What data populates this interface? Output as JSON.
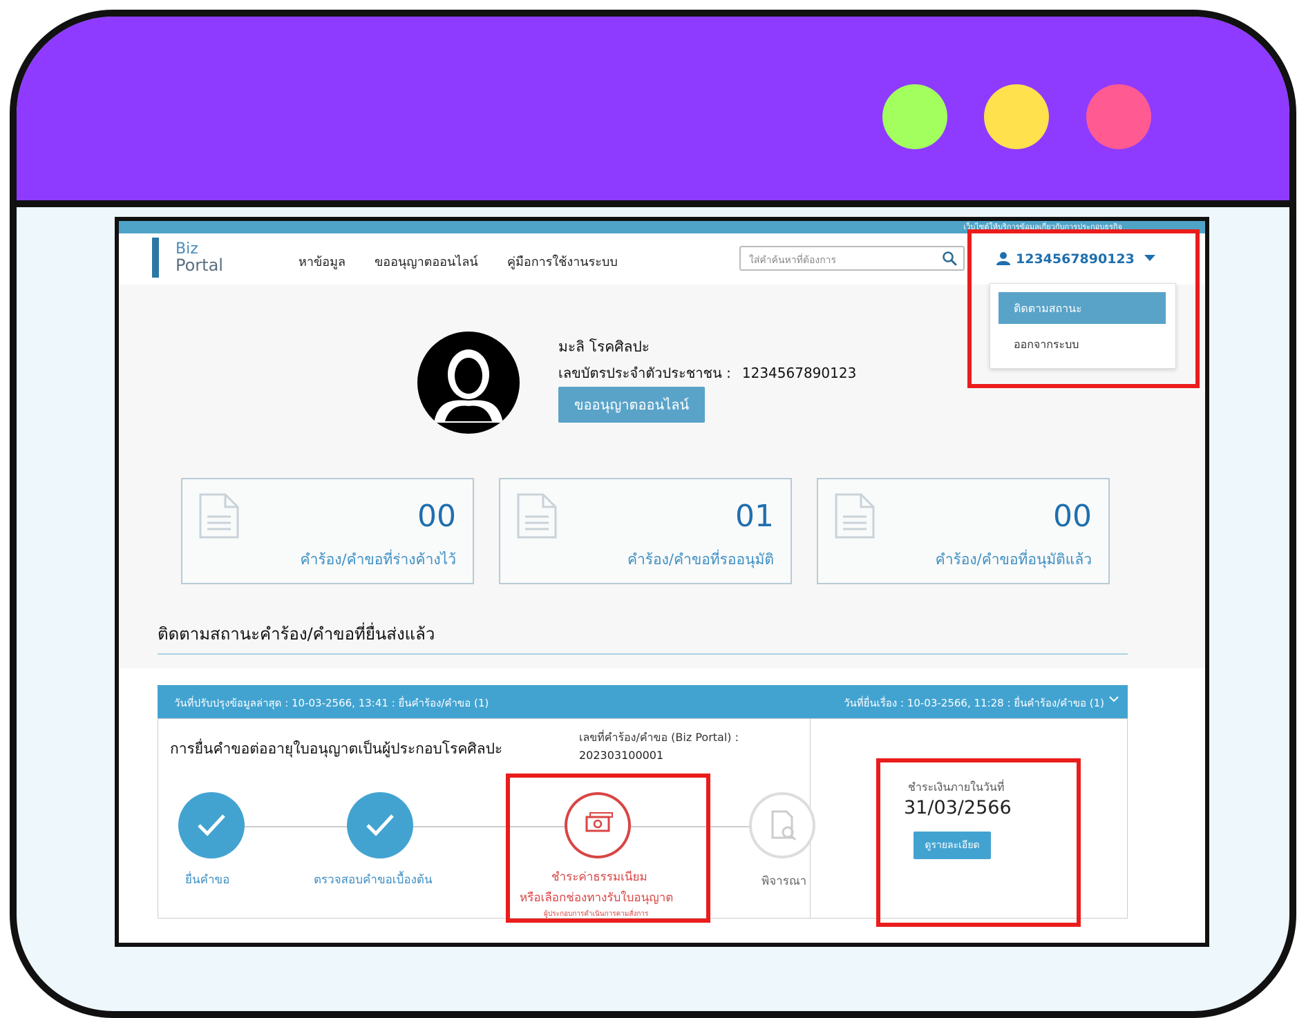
{
  "top_strip": "เว็บไซต์ให้บริการข้อมูลเกี่ยวกับการประกอบธุรกิจ",
  "logo": {
    "line1": "Biz",
    "line2": "Portal"
  },
  "nav": {
    "links": [
      "หาข้อมูล",
      "ขออนุญาตออนไลน์",
      "คู่มือการใช้งานระบบ"
    ],
    "search_placeholder": "ใส่คำค้นหาที่ต้องการ",
    "user_id": "1234567890123"
  },
  "dropdown": {
    "items": [
      "ติดตามสถานะ",
      "ออกจากระบบ"
    ]
  },
  "profile": {
    "name": "มะลิ  โรคศิลปะ",
    "id_label": "เลขบัตรประจำตัวประชาชน :",
    "id_value": "1234567890123",
    "button": "ขออนุญาตออนไลน์"
  },
  "cards": [
    {
      "count": "00",
      "label": "คำร้อง/คำขอที่ร่างค้างไว้"
    },
    {
      "count": "01",
      "label": "คำร้อง/คำขอที่รออนุมัติ"
    },
    {
      "count": "00",
      "label": "คำร้อง/คำขอที่อนุมัติแล้ว"
    }
  ],
  "section_title": "ติดตามสถานะคำร้อง/คำขอที่ยื่นส่งแล้ว",
  "request": {
    "bar_left": "วันที่ปรับปรุงข้อมูลล่าสุด : 10-03-2566, 13:41 : ยื่นคำร้อง/คำขอ (1)",
    "bar_right": "วันที่ยื่นเรื่อง : 10-03-2566, 11:28 : ยื่นคำร้อง/คำขอ (1)",
    "title": "การยื่นคำขอต่ออายุใบอนุญาตเป็นผู้ประกอบโรคศิลปะ",
    "number_label": "เลขที่คำร้อง/คำขอ (Biz Portal) :",
    "number": "202303100001",
    "steps": {
      "s1": "ยื่นคำขอ",
      "s2": "ตรวจสอบคำขอเบื้องต้น",
      "s3_line1": "ชำระค่าธรรมเนียม",
      "s3_line2": "หรือเลือกช่องทางรับใบอนุญาต",
      "s3_line3": "ผู้ประกอบการดำเนินการตามสั่งการ",
      "s4": "พิจารณา"
    },
    "pay_label": "ชำระเงินภายในวันที่",
    "pay_date": "31/03/2566",
    "detail_button": "ดูรายละเอียด"
  },
  "colors": {
    "frame": "#8e3bff",
    "accent": "#42a3d1",
    "highlight": "#ea1c1c"
  }
}
